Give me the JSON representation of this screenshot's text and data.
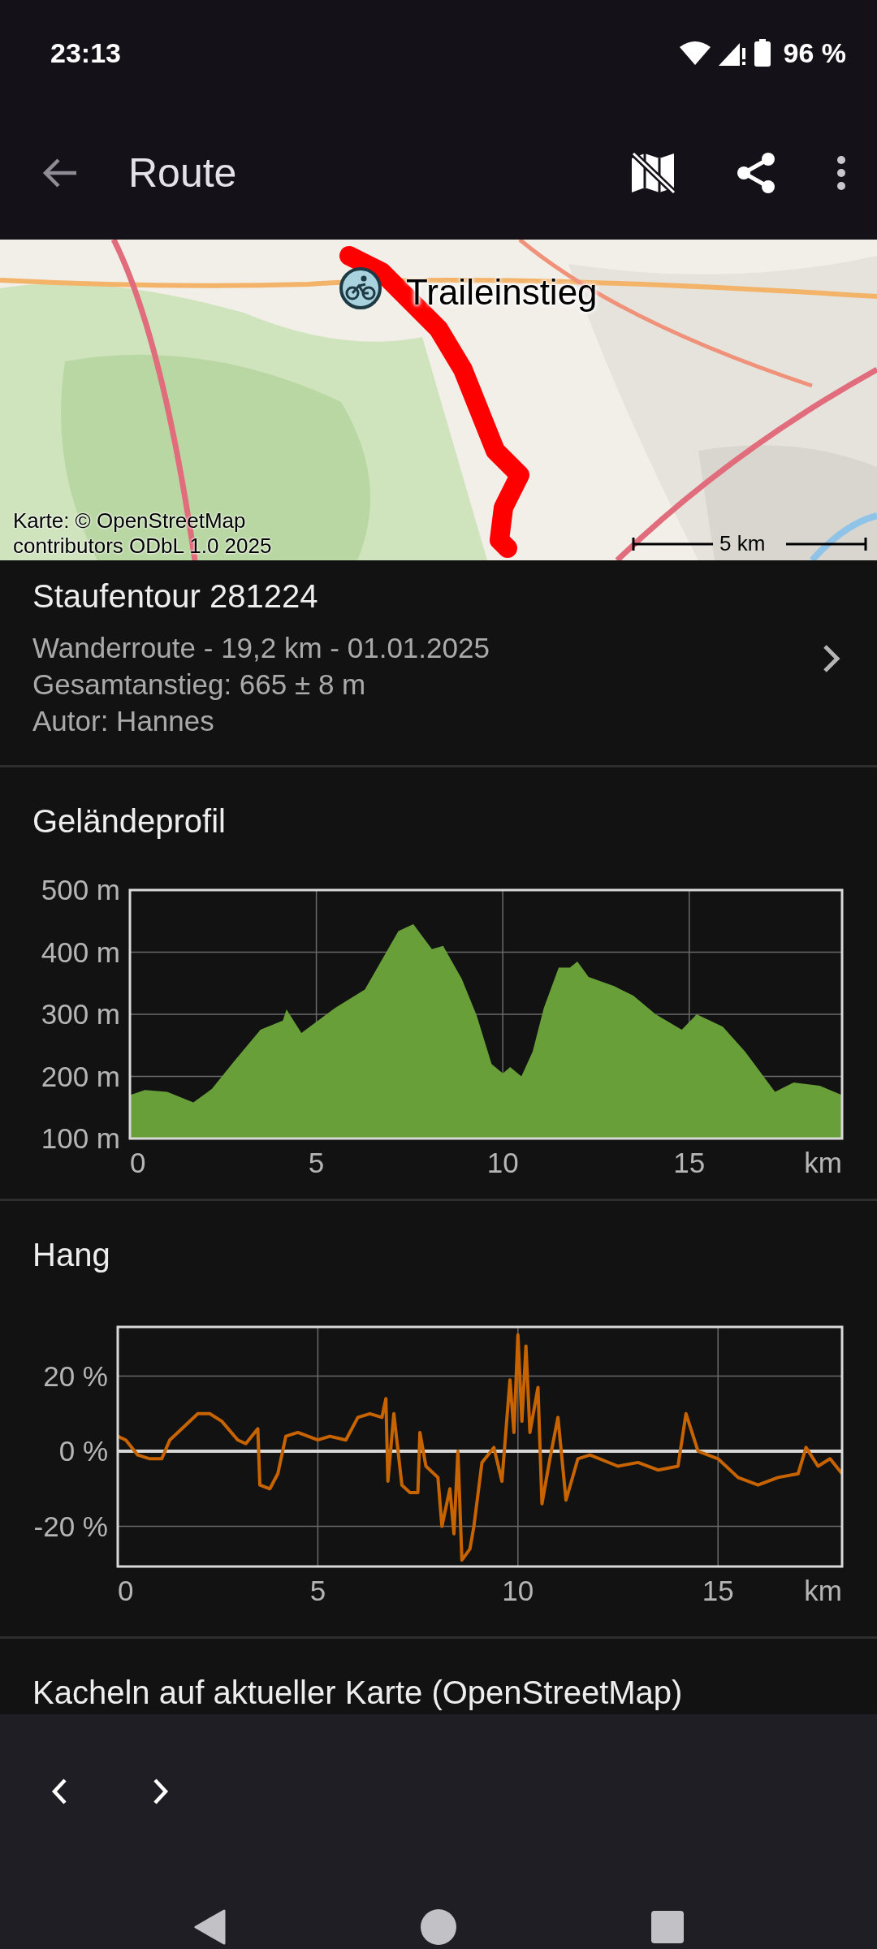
{
  "status_bar": {
    "time": "23:13",
    "battery": "96 %"
  },
  "app_bar": {
    "title": "Route"
  },
  "map": {
    "kind": "picture",
    "marker_label": "Traileinstieg",
    "attribution": "Karte: © OpenStreetMap contributors ODbL 1.0 2025",
    "scale": "5 km"
  },
  "route": {
    "title": "Staufentour 281224",
    "details": [
      "Wanderroute - 19,2 km - 01.01.2025",
      "Gesamtanstieg: 665 ± 8 m",
      "Autor: Hannes"
    ]
  },
  "sections": [
    {
      "title": "Geländeprofil",
      "chart_data": {
        "type": "area",
        "xlabel": "km",
        "x": [
          0,
          0.4,
          1,
          1.7,
          2.2,
          2.8,
          3.5,
          4.1,
          4.2,
          4.6,
          5.5,
          6.3,
          7.2,
          7.6,
          8.1,
          8.4,
          8.9,
          9.3,
          9.7,
          10,
          10.2,
          10.5,
          10.8,
          11.1,
          11.5,
          11.8,
          12,
          12.3,
          13,
          13.5,
          14.1,
          14.8,
          15.2,
          15.9,
          16.5,
          17.3,
          17.8,
          18.5,
          19.1
        ],
        "grid": true,
        "series": [
          {
            "color": "#689f38",
            "values": [
              170,
              178,
              175,
              158,
              180,
              225,
              275,
              290,
              308,
              270,
              310,
              340,
              434,
              445,
              405,
              410,
              357,
              298,
              220,
              205,
              215,
              200,
              240,
              310,
              375,
              375,
              385,
              360,
              345,
              330,
              300,
              275,
              300,
              280,
              240,
              175,
              190,
              185,
              170
            ]
          }
        ],
        "xlim": [
          0,
          19.1
        ],
        "ylim": [
          100,
          500
        ],
        "xticks": [
          0,
          5,
          10,
          15
        ],
        "yticks": [
          {
            "value": 100,
            "label": "100 m"
          },
          {
            "value": 200,
            "label": "200 m"
          },
          {
            "value": 300,
            "label": "300 m"
          },
          {
            "value": 400,
            "label": "400 m"
          },
          {
            "value": 500,
            "label": "500 m"
          }
        ]
      }
    },
    {
      "title": "Hang",
      "chart_data": {
        "type": "line",
        "xlabel": "km",
        "x": [
          0,
          0.2,
          0.5,
          0.8,
          1.1,
          1.3,
          1.7,
          2,
          2.3,
          2.6,
          3,
          3.2,
          3.5,
          3.55,
          3.8,
          4,
          4.2,
          4.5,
          5,
          5.3,
          5.7,
          6,
          6.3,
          6.6,
          6.7,
          6.75,
          6.9,
          7.1,
          7.3,
          7.5,
          7.55,
          7.7,
          8,
          8.1,
          8.3,
          8.4,
          8.5,
          8.6,
          8.8,
          8.9,
          9.1,
          9.4,
          9.6,
          9.8,
          9.9,
          10,
          10.1,
          10.2,
          10.3,
          10.5,
          10.6,
          10.8,
          11,
          11.2,
          11.5,
          11.8,
          12.5,
          13,
          13.5,
          14,
          14.2,
          14.5,
          15,
          15.5,
          16,
          16.5,
          17,
          17.2,
          17.5,
          17.8,
          18.1
        ],
        "grid": true,
        "series": [
          {
            "color": "#c86400",
            "values": [
              4,
              3,
              -1,
              -2,
              -2,
              3,
              7,
              10,
              10,
              8,
              3,
              2,
              6,
              -9,
              -10,
              -6,
              4,
              5,
              3,
              4,
              3,
              9,
              10,
              9,
              14,
              -8,
              10,
              -9,
              -11,
              -11,
              5,
              -4,
              -7,
              -20,
              -10,
              -22,
              0,
              -29,
              -26,
              -20,
              -3,
              1,
              -8,
              19,
              5,
              31,
              8,
              28,
              5,
              17,
              -14,
              -2,
              9,
              -13,
              -2,
              -1,
              -4,
              -3,
              -5,
              -4,
              10,
              0,
              -2,
              -7,
              -9,
              -7,
              -6,
              1,
              -4,
              -2,
              -6
            ]
          }
        ],
        "xlim": [
          0,
          18.1
        ],
        "ylim": [
          -30.7,
          33.1
        ],
        "xticks": [
          0,
          5,
          10,
          15
        ],
        "yticks": [
          {
            "value": -20,
            "label": "-20 %"
          },
          {
            "value": 0,
            "label": "0 %"
          },
          {
            "value": 20,
            "label": "20 %"
          }
        ]
      }
    },
    {
      "title": "Kacheln auf aktueller Karte (OpenStreetMap)"
    }
  ]
}
